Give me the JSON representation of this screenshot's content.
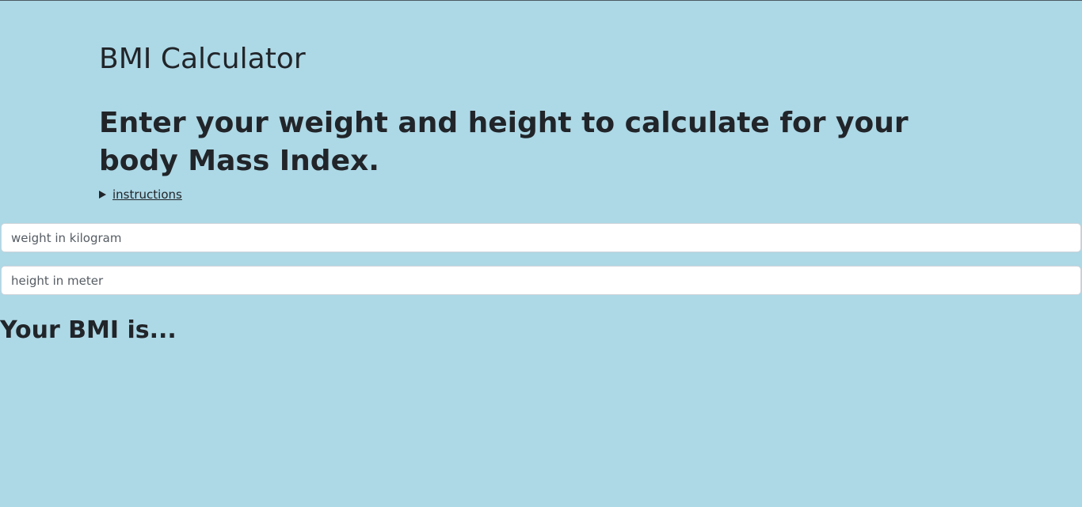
{
  "header": {
    "title": "BMI Calculator",
    "subtitle": "Enter your weight and height to calculate for your body Mass Index."
  },
  "instructions": {
    "label": "instructions",
    "icon": "disclosure-triangle-icon"
  },
  "form": {
    "weight": {
      "placeholder": "weight in kilogram",
      "value": ""
    },
    "height": {
      "placeholder": "height in meter",
      "value": ""
    }
  },
  "result": {
    "text": "Your BMI is..."
  },
  "colors": {
    "background": "#add8e6",
    "text": "#212529"
  }
}
